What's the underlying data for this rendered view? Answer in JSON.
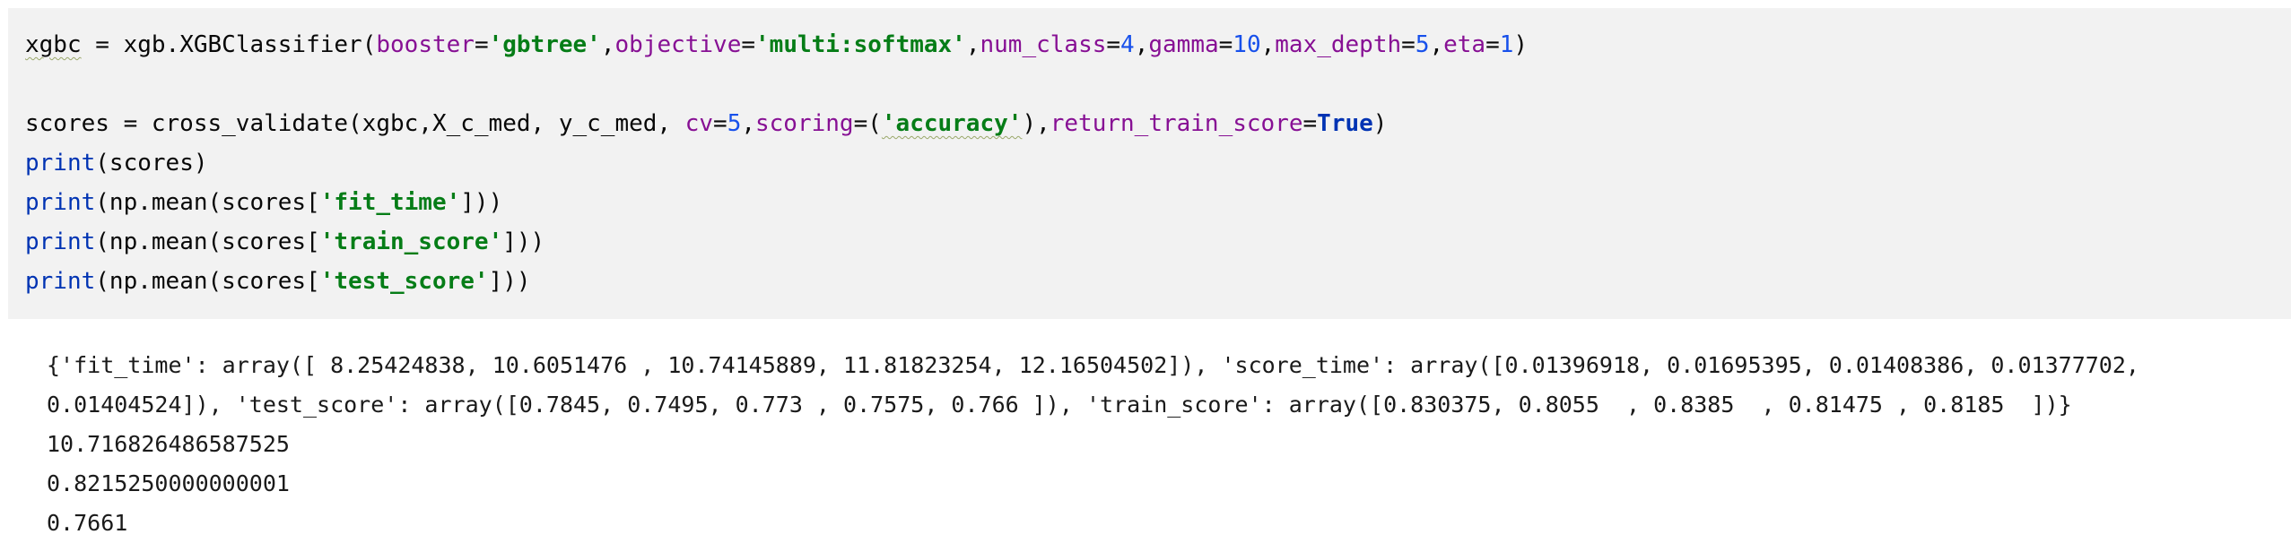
{
  "code": {
    "line1": {
      "var": "xgbc",
      "eq": " = ",
      "callee": "xgb.XGBClassifier(",
      "p_booster": "booster",
      "v_booster": "'gbtree'",
      "p_objective": "objective",
      "v_objective": "'multi:softmax'",
      "p_num_class": "num_class",
      "v_num_class": "4",
      "p_gamma": "gamma",
      "v_gamma": "10",
      "p_max_depth": "max_depth",
      "v_max_depth": "5",
      "p_eta": "eta",
      "v_eta": "1",
      "close": ")"
    },
    "line3": {
      "lhs": "scores = cross_validate(xgbc,X_c_med, y_c_med, ",
      "p_cv": "cv",
      "v_cv": "5",
      "p_scoring": "scoring",
      "open": "=(",
      "v_scoring": "'accuracy'",
      "close_paren": ")",
      "p_return": "return_train_score",
      "v_return": "True",
      "close": ")"
    },
    "line4": {
      "fn": "print",
      "rest": "(scores)"
    },
    "line5": {
      "fn": "print",
      "pre": "(np.mean(scores[",
      "key": "'fit_time'",
      "post": "]))"
    },
    "line6": {
      "fn": "print",
      "pre": "(np.mean(scores[",
      "key": "'train_score'",
      "post": "]))"
    },
    "line7": {
      "fn": "print",
      "pre": "(np.mean(scores[",
      "key": "'test_score'",
      "post": "]))"
    }
  },
  "output": {
    "line1": "{'fit_time': array([ 8.25424838, 10.6051476 , 10.74145889, 11.81823254, 12.16504502]), 'score_time': array([0.01396918, 0.01695395, 0.01408386, 0.01377702,",
    "line2": "0.01404524]), 'test_score': array([0.7845, 0.7495, 0.773 , 0.7575, 0.766 ]), 'train_score': array([0.830375, 0.8055  , 0.8385  , 0.81475 , 0.8185  ])}",
    "line3": "10.716826486587525",
    "line4": "0.8215250000000001",
    "line5": "0.7661"
  }
}
